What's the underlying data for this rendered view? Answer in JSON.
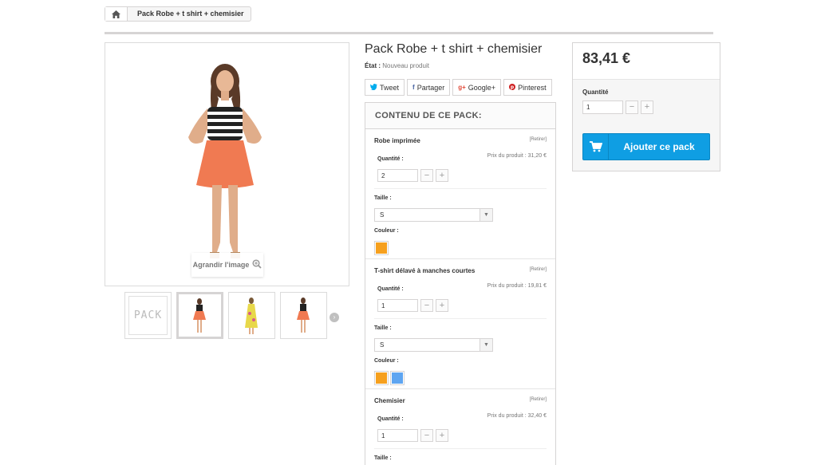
{
  "breadcrumb": {
    "home_icon": "home-icon",
    "current": "Pack Robe + t shirt + chemisier"
  },
  "gallery": {
    "zoom_label": "Agrandir l'image",
    "zoom_icon": "zoom-in-icon",
    "pack_thumb_text": "PACK"
  },
  "product": {
    "title": "Pack Robe + t shirt + chemisier",
    "etat_label": "État :",
    "etat_value": "Nouveau produit"
  },
  "social": {
    "tweet": "Tweet",
    "partager": "Partager",
    "google": "Google+",
    "pinterest": "Pinterest"
  },
  "pack": {
    "heading": "CONTENU DE CE PACK:",
    "items": [
      {
        "name": "Robe imprimée",
        "remove": "[Retirer]",
        "qty_label": "Quantité :",
        "price": "Prix du produit : 31,20 €",
        "qty": "2",
        "taille_label": "Taille :",
        "taille": "S",
        "couleur_label": "Couleur :",
        "colors": [
          "#f6a01e"
        ]
      },
      {
        "name": "T-shirt délavé à manches courtes",
        "remove": "[Retirer]",
        "qty_label": "Quantité :",
        "price": "Prix du produit : 19,81 €",
        "qty": "1",
        "taille_label": "Taille :",
        "taille": "S",
        "couleur_label": "Couleur :",
        "colors": [
          "#f6a01e",
          "#5ea5f1"
        ]
      },
      {
        "name": "Chemisier",
        "remove": "[Retirer]",
        "qty_label": "Quantité :",
        "price": "Prix du produit : 32,40 €",
        "qty": "1",
        "taille_label": "Taille :"
      }
    ]
  },
  "buy": {
    "price": "83,41 €",
    "qty_label": "Quantité",
    "qty": "1",
    "button_label": "Ajouter ce pack"
  }
}
